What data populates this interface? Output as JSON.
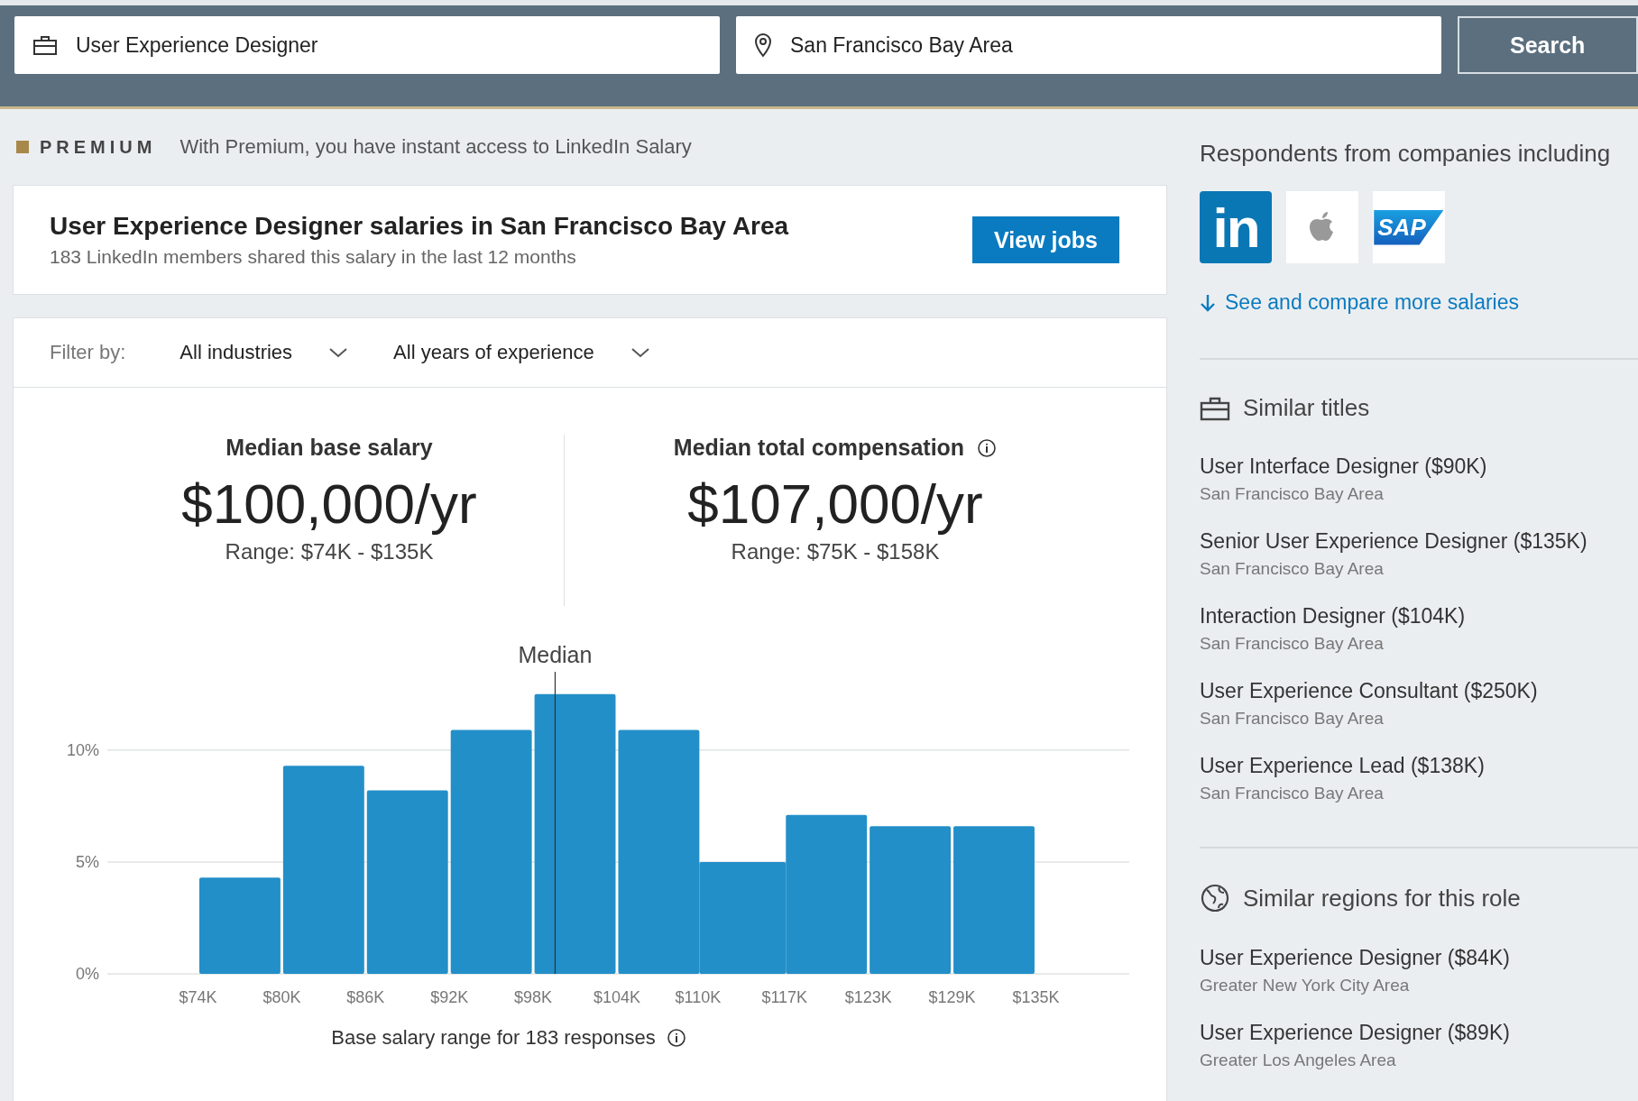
{
  "search": {
    "keywords": "User Experience Designer",
    "location": "San Francisco Bay Area",
    "button": "Search"
  },
  "premium": {
    "label": "PREMIUM",
    "message": "With Premium, you have instant access to LinkedIn Salary"
  },
  "header": {
    "title": "User Experience Designer salaries in San Francisco Bay Area",
    "subtitle": "183 LinkedIn members shared this salary in the last 12 months",
    "button": "View jobs"
  },
  "filters": {
    "label": "Filter by:",
    "dropdowns": [
      {
        "value": "All industries"
      },
      {
        "value": "All years of experience"
      }
    ]
  },
  "stats": [
    {
      "label": "Median base salary",
      "value": "$100,000/yr",
      "range": "Range: $74K - $135K",
      "info": false
    },
    {
      "label": "Median total compensation",
      "value": "$107,000/yr",
      "range": "Range: $75K - $158K",
      "info": true
    }
  ],
  "chart_data": {
    "type": "bar",
    "x": [
      77.05,
      83.15,
      89.25,
      95.35,
      101.45,
      107.55,
      113.65,
      119.75,
      125.85,
      131.95
    ],
    "values": [
      4.3,
      9.3,
      8.2,
      10.9,
      12.5,
      10.9,
      5.0,
      7.1,
      6.6,
      6.6
    ],
    "xlim": [
      67.4,
      141.8
    ],
    "ylim": [
      0,
      13.5
    ],
    "yticks": [
      {
        "value": 0,
        "label": "0%"
      },
      {
        "value": 5,
        "label": "5%"
      },
      {
        "value": 10,
        "label": "10%"
      }
    ],
    "xticks": [
      {
        "value": 74,
        "label": "$74K"
      },
      {
        "value": 80.1,
        "label": "$80K"
      },
      {
        "value": 86.2,
        "label": "$86K"
      },
      {
        "value": 92.3,
        "label": "$92K"
      },
      {
        "value": 98.4,
        "label": "$98K"
      },
      {
        "value": 104.5,
        "label": "$104K"
      },
      {
        "value": 110.4,
        "label": "$110K"
      },
      {
        "value": 116.7,
        "label": "$117K"
      },
      {
        "value": 122.8,
        "label": "$123K"
      },
      {
        "value": 128.9,
        "label": "$129K"
      },
      {
        "value": 135,
        "label": "$135K"
      }
    ],
    "ref_lines": [
      {
        "axis": "x",
        "value": 100,
        "label": "Median"
      }
    ],
    "xlabel": "Base salary range for 183 responses"
  },
  "sidebar": {
    "respondents_title": "Respondents from companies including",
    "companies": [
      {
        "kind": "linkedin",
        "text": "in"
      },
      {
        "kind": "apple"
      },
      {
        "kind": "sap",
        "text": "SAP"
      }
    ],
    "compare_link": "See and compare more salaries",
    "similar_titles": {
      "title": "Similar titles",
      "items": [
        {
          "title": "User Interface Designer ($90K)",
          "region": "San Francisco Bay Area"
        },
        {
          "title": "Senior User Experience Designer ($135K)",
          "region": "San Francisco Bay Area"
        },
        {
          "title": "Interaction Designer ($104K)",
          "region": "San Francisco Bay Area"
        },
        {
          "title": "User Experience Consultant ($250K)",
          "region": "San Francisco Bay Area"
        },
        {
          "title": "User Experience Lead ($138K)",
          "region": "San Francisco Bay Area"
        }
      ]
    },
    "similar_regions": {
      "title": "Similar regions for this role",
      "items": [
        {
          "title": "User Experience Designer ($84K)",
          "region": "Greater New York City Area"
        },
        {
          "title": "User Experience Designer ($89K)",
          "region": "Greater Los Angeles Area"
        }
      ]
    }
  }
}
